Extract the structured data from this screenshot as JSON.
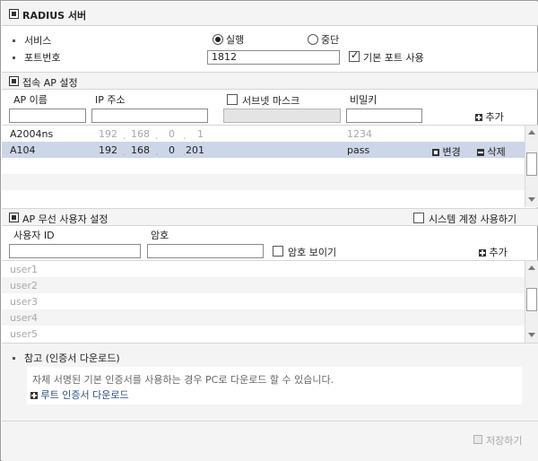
{
  "title": "RADIUS 서버",
  "service": {
    "label": "서비스",
    "options": [
      "실행",
      "중단"
    ],
    "selected": "실행"
  },
  "port": {
    "label": "포트번호",
    "value": "1812",
    "default_port_label": "기본 포트 사용",
    "default_port_checked": true
  },
  "ap_section": {
    "title": "접속 AP 설정",
    "headers": {
      "name": "AP 이름",
      "ip": "IP 주소",
      "subnet": "서브넷 마스크",
      "password": "비밀키"
    },
    "add_label": "추가",
    "rows": [
      {
        "name": "A2004ns",
        "ip": [
          "192",
          "168",
          "0",
          "1"
        ],
        "password": "1234",
        "selected": false
      },
      {
        "name": "A104",
        "ip": [
          "192",
          "168",
          "0",
          "201"
        ],
        "password": "pass",
        "selected": true,
        "edit_label": "변경",
        "delete_label": "삭제"
      }
    ]
  },
  "user_section": {
    "title": "AP 무선 사용자 설정",
    "system_account_label": "시스템 계정 사용하기",
    "headers": {
      "user_id": "사용자 ID",
      "password": "암호"
    },
    "show_password_label": "암호 보이기",
    "add_label": "추가",
    "placeholders": [
      "user1",
      "user2",
      "user3",
      "user4",
      "user5"
    ]
  },
  "note": {
    "title": "참고 (인증서 다운로드)",
    "text": "자체 서명된 기본 인증서를 사용하는 경우 PC로 다운로드 할 수 있습니다.",
    "link": "루트 인증서 다운로드"
  },
  "footer": {
    "save_label": "저장하기"
  }
}
